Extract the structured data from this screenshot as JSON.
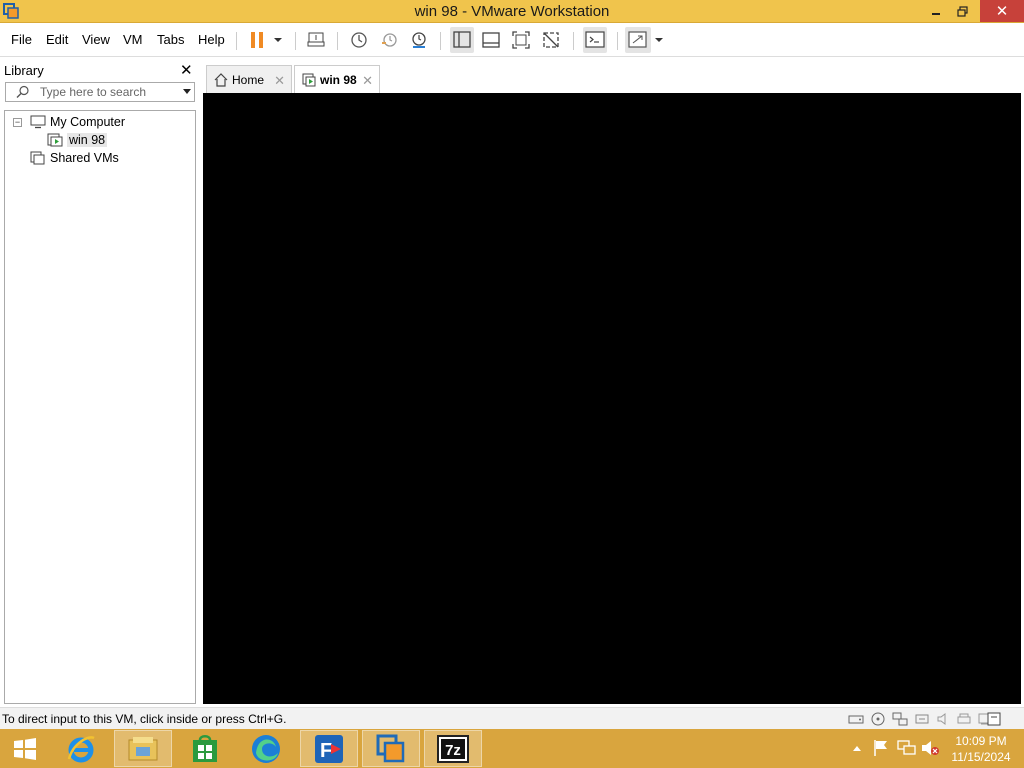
{
  "window": {
    "title": "win 98 - VMware Workstation",
    "minimize_glyph": "🗕",
    "restore_glyph": "🗗",
    "close_glyph": "✕"
  },
  "menu": {
    "items": [
      "File",
      "Edit",
      "View",
      "VM",
      "Tabs",
      "Help"
    ]
  },
  "toolbar": {
    "icons": [
      "pause-icon",
      "dropdown-icon",
      "send-keys-icon",
      "snapshot-icon",
      "revert-snapshot-icon",
      "snapshot-manager-icon",
      "show-library-icon",
      "show-thumbnail-icon",
      "full-screen-icon",
      "unity-icon",
      "console-view-icon",
      "stretch-guest-icon",
      "dropdown-icon"
    ],
    "accent": "#f08a24"
  },
  "library": {
    "title": "Library",
    "close_glyph": "✕",
    "search_placeholder": "Type here to search",
    "tree": {
      "root_label": "My Computer",
      "root_expander": "−",
      "vm_label": "win 98",
      "shared_label": "Shared VMs"
    }
  },
  "tabs": [
    {
      "label": "Home",
      "icon": "home-icon",
      "close": "✕"
    },
    {
      "label": "win 98",
      "icon": "vm-icon",
      "close": "✕"
    }
  ],
  "status": {
    "message": "To direct input to this VM, click inside or press Ctrl+G."
  },
  "taskbar": {
    "apps": [
      "windows-start-icon",
      "internet-explorer-icon",
      "file-explorer-icon",
      "store-icon",
      "edge-icon",
      "filezilla-icon",
      "vmware-icon",
      "7zip-icon"
    ],
    "sevenzip_label": "7z",
    "clock_time": "10:09 PM",
    "clock_date": "11/15/2024"
  },
  "colors": {
    "title_bar": "#f0c44c",
    "taskbar": "#d9a53e",
    "close_button": "#c7413a",
    "vm_screen": "#000000"
  }
}
